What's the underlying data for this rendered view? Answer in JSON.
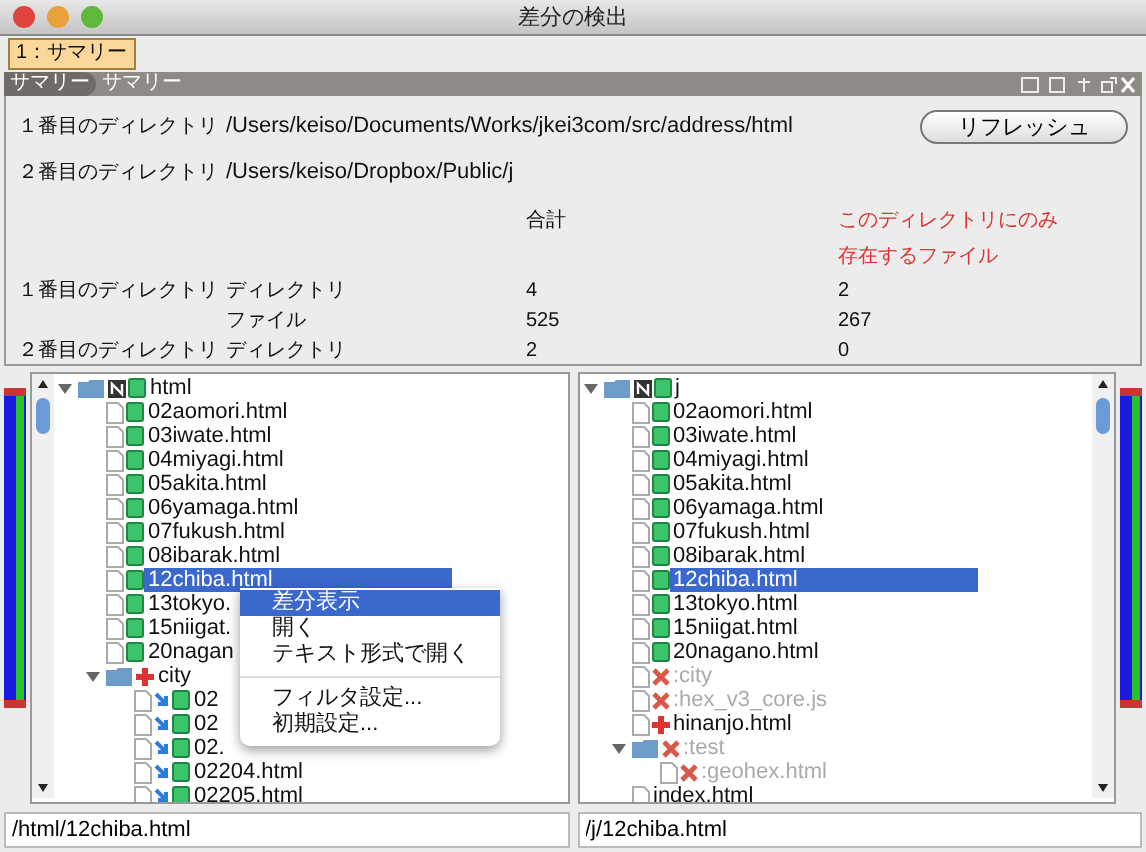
{
  "window": {
    "title": "差分の検出"
  },
  "tabs": [
    {
      "label": "1：サマリー",
      "selected": true
    }
  ],
  "panel": {
    "tabs": [
      {
        "label": "サマリー",
        "selected": true
      },
      {
        "label": "サマリー",
        "selected": false
      }
    ]
  },
  "summary": {
    "directories": [
      {
        "label": "１番目のディレクトリ",
        "path": "/Users/keiso/Documents/Works/jkei3com/src/address/html"
      },
      {
        "label": "２番目のディレクトリ",
        "path": "/Users/keiso/Dropbox/Public/j"
      }
    ],
    "refresh_button": "リフレッシュ",
    "table": {
      "columns": [
        "合計",
        "このディレクトリにのみ存在するファイル"
      ],
      "rows": [
        {
          "directory": "１番目のディレクトリ",
          "type": "ディレクトリ",
          "total": "4",
          "unique": "2"
        },
        {
          "type": "ファイル",
          "total": "525",
          "unique": "267"
        },
        {
          "directory": "２番目のディレクトリ",
          "type": "ディレクトリ",
          "total": "2",
          "unique": "0"
        }
      ]
    }
  },
  "left_tree": {
    "path": "/html/12chiba.html",
    "nodes": [
      {
        "label": "html",
        "kind": "same",
        "folder": true,
        "expanded": true,
        "selected": false,
        "children": [
          {
            "label": "02aomori.html",
            "kind": "same",
            "selected": false
          },
          {
            "label": "03iwate.html",
            "kind": "same",
            "selected": false
          },
          {
            "label": "04miyagi.html",
            "kind": "same",
            "selected": false
          },
          {
            "label": "05akita.html",
            "kind": "same",
            "selected": false
          },
          {
            "label": "06yamaga.html",
            "kind": "same",
            "selected": false
          },
          {
            "label": "07fukush.html",
            "kind": "same",
            "selected": false
          },
          {
            "label": "08ibarak.html",
            "kind": "same",
            "selected": false
          },
          {
            "label": "12chiba.html",
            "kind": "same",
            "selected": true
          },
          {
            "label": "13tokyo.",
            "kind": "same",
            "selected": false
          },
          {
            "label": "15niigat.",
            "kind": "same",
            "selected": false
          },
          {
            "label": "20nagan",
            "kind": "same",
            "selected": false
          },
          {
            "label": "city",
            "kind": "added",
            "folder": true,
            "expanded": true,
            "selected": false,
            "children": [
              {
                "label": "02",
                "kind": "changed",
                "selected": false
              },
              {
                "label": "02",
                "kind": "changed",
                "selected": false
              },
              {
                "label": "02.",
                "kind": "changed",
                "selected": false
              },
              {
                "label": "02204.html",
                "kind": "changed",
                "selected": false
              },
              {
                "label": "02205.html",
                "kind": "changed",
                "selected": false
              }
            ]
          }
        ]
      }
    ]
  },
  "right_tree": {
    "path": "/j/12chiba.html",
    "nodes": [
      {
        "label": "j",
        "kind": "same",
        "folder": true,
        "expanded": true,
        "selected": false,
        "children": [
          {
            "label": "02aomori.html",
            "kind": "same",
            "selected": false
          },
          {
            "label": "03iwate.html",
            "kind": "same",
            "selected": false
          },
          {
            "label": "04miyagi.html",
            "kind": "same",
            "selected": false
          },
          {
            "label": "05akita.html",
            "kind": "same",
            "selected": false
          },
          {
            "label": "06yamaga.html",
            "kind": "same",
            "selected": false
          },
          {
            "label": "07fukush.html",
            "kind": "same",
            "selected": false
          },
          {
            "label": "08ibarak.html",
            "kind": "same",
            "selected": false
          },
          {
            "label": "12chiba.html",
            "kind": "same",
            "selected": true
          },
          {
            "label": "13tokyo.html",
            "kind": "same",
            "selected": false
          },
          {
            "label": "15niigat.html",
            "kind": "same",
            "selected": false
          },
          {
            "label": "20nagano.html",
            "kind": "same",
            "selected": false
          },
          {
            "label": ":city",
            "kind": "missing",
            "selected": false
          },
          {
            "label": ":hex_v3_core.js",
            "kind": "missing",
            "selected": false
          },
          {
            "label": "hinanjo.html",
            "kind": "added",
            "selected": false
          },
          {
            "label": ":test",
            "kind": "missing",
            "folder": true,
            "expanded": true,
            "selected": false,
            "children": [
              {
                "label": ":geohex.html",
                "kind": "missing",
                "selected": false
              }
            ]
          },
          {
            "label": "index.html",
            "kind": "plain",
            "selected": false
          }
        ]
      }
    ]
  },
  "context_menu": {
    "groups": [
      [
        {
          "label": "差分表示",
          "selected": true
        },
        {
          "label": "開く",
          "selected": false
        },
        {
          "label": "テキスト形式で開く",
          "selected": false
        }
      ],
      [
        {
          "label": "フィルタ設定...",
          "selected": false
        },
        {
          "label": "初期設定...",
          "selected": false
        }
      ]
    ]
  }
}
